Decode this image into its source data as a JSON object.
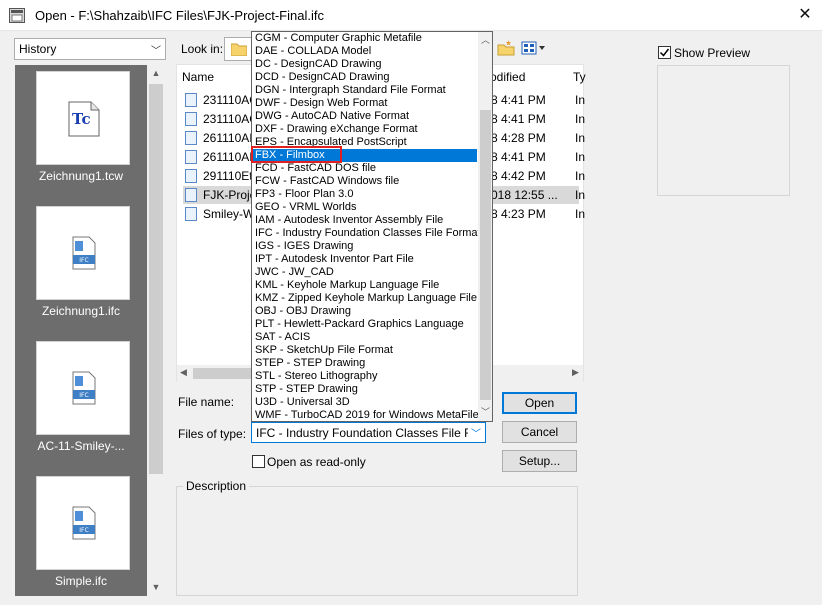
{
  "window": {
    "title": "Open - F:\\Shahzaib\\IFC Files\\FJK-Project-Final.ifc",
    "close_glyph": "✕"
  },
  "history": {
    "selected": "History",
    "items": [
      {
        "label": "Zeichnung1.tcw",
        "icon": "tc-icon"
      },
      {
        "label": "Zeichnung1.ifc",
        "icon": "ifc-file-icon",
        "badge": "IFC"
      },
      {
        "label": "AC-11-Smiley-...",
        "icon": "ifc-file-icon",
        "badge": "IFC"
      },
      {
        "label": "Simple.ifc",
        "icon": "ifc-file-icon",
        "badge": "IFC"
      }
    ]
  },
  "tc_glyph": "Tc",
  "look_in": {
    "label": "Look in:"
  },
  "file_list": {
    "headers": {
      "name": "Name",
      "modified": "odified",
      "type": "Ty"
    },
    "rows": [
      {
        "name": "231110AC",
        "date": "8 4:41 PM",
        "type": "In"
      },
      {
        "name": "231110AC",
        "date": "8 4:41 PM",
        "type": "In"
      },
      {
        "name": "261110AI",
        "date": "8 4:28 PM",
        "type": "In"
      },
      {
        "name": "261110AI",
        "date": "8 4:41 PM",
        "type": "In"
      },
      {
        "name": "291110Ett",
        "date": "8 4:42 PM",
        "type": "In"
      },
      {
        "name": "FJK-Projec",
        "date": "018 12:55 ...",
        "type": "In",
        "selected": true
      },
      {
        "name": "Smiley-W",
        "date": "8 4:23 PM",
        "type": "In"
      }
    ]
  },
  "file_types": [
    "CGM  - Computer Graphic Metafile",
    "DAE  - COLLADA Model",
    "DC    - DesignCAD Drawing",
    "DCD  - DesignCAD Drawing",
    "DGN  - Intergraph Standard File Format",
    "DWF - Design Web Format",
    "DWG - AutoCAD Native Format",
    "DXF   - Drawing eXchange Format",
    "EPS   - Encapsulated PostScript",
    "FBX   - Filmbox",
    "FCD   - FastCAD DOS file",
    "FCW  - FastCAD Windows file",
    "FP3   - Floor Plan 3.0",
    "GEO  - VRML Worlds",
    "IAM   - Autodesk Inventor Assembly File",
    "IFC    - Industry Foundation Classes File Format",
    "IGS    - IGES Drawing",
    "IPT    - Autodesk Inventor Part File",
    "JWC  - JW_CAD",
    "KML  - Keyhole Markup Language File",
    "KMZ  - Zipped Keyhole Markup Language File",
    "OBJ   - OBJ Drawing",
    "PLT    - Hewlett-Packard Graphics Language",
    "SAT   - ACIS",
    "SKP   - SketchUp File Format",
    "STEP  - STEP Drawing",
    "STL    - Stereo Lithography",
    "STP    - STEP Drawing",
    "U3D   - Universal 3D",
    "WMF - TurboCAD 2019 for Windows MetaFile"
  ],
  "highlighted_type_index": 9,
  "form": {
    "file_name_label": "File name:",
    "files_of_type_label": "Files of type:",
    "files_of_type_value": "IFC    - Industry Foundation Classes File Form",
    "open_button": "Open",
    "cancel_button": "Cancel",
    "setup_button": "Setup...",
    "read_only_label": "Open as read-only",
    "description_label": "Description"
  },
  "preview": {
    "label": "Show Preview",
    "checked": true
  },
  "colors": {
    "accent": "#0078d7",
    "highlight_box": "#e02020",
    "history_bg": "#6d6d6d"
  }
}
